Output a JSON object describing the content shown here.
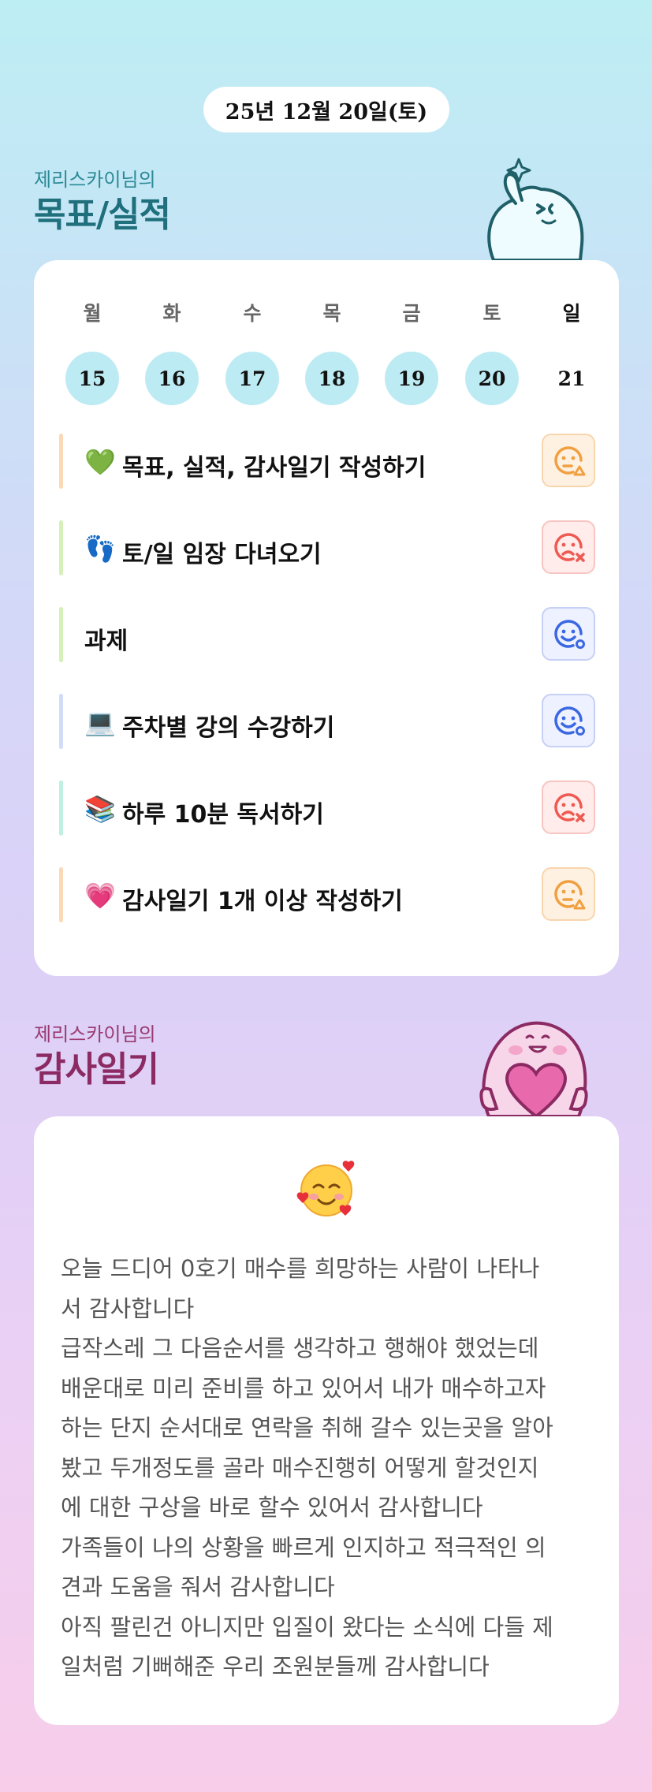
{
  "date_label": "25년 12월 20일(토)",
  "goals_section": {
    "subtitle": "제리스카이님의",
    "title": "목표/실적"
  },
  "week": {
    "day_names": [
      "월",
      "화",
      "수",
      "목",
      "금",
      "토",
      "일"
    ],
    "day_numbers": [
      "15",
      "16",
      "17",
      "18",
      "19",
      "20",
      "21"
    ]
  },
  "goals": [
    {
      "emoji": "💚",
      "text": "목표, 실적, 감사일기 작성하기",
      "status_icon": "neutral-face-warning-icon",
      "bar_color": "#fbd9b6"
    },
    {
      "emoji": "👣",
      "text": "토/일 임장 다녀오기",
      "status_icon": "sad-face-x-icon",
      "bar_color": "#d5f0b8"
    },
    {
      "emoji": "",
      "text": "과제",
      "status_icon": "smile-face-check-icon",
      "bar_color": "#d5f0b8"
    },
    {
      "emoji": "💻",
      "text": "주차별 강의 수강하기",
      "status_icon": "smile-face-check-icon",
      "bar_color": "#d2dcf8"
    },
    {
      "emoji": "📚",
      "text": "하루 10분 독서하기",
      "status_icon": "sad-face-x-icon",
      "bar_color": "#bff0e2"
    },
    {
      "emoji": "💗",
      "text": "감사일기 1개 이상 작성하기",
      "status_icon": "neutral-face-warning-icon",
      "bar_color": "#fbd9b6"
    }
  ],
  "colors": {
    "warn": "#f0a040",
    "fail": "#ee5a52",
    "good": "#3a68e2",
    "teal_title": "#1f6f7c",
    "pink_title": "#8c2a63"
  },
  "diary_section": {
    "subtitle": "제리스카이님의",
    "title": "감사일기"
  },
  "diary": {
    "emoji_icon": "smiling-face-with-hearts-icon",
    "lines": [
      "오늘 드디어 0호기 매수를 희망하는 사람이 나타나",
      "서 감사합니다",
      "급작스레 그 다음순서를 생각하고 행해야 했었는데",
      "배운대로 미리 준비를 하고 있어서 내가 매수하고자",
      "하는 단지 순서대로 연락을 취해 갈수 있는곳을 알아",
      "봤고 두개정도를 골라 매수진행히 어떻게 할것인지",
      "에 대한 구상을 바로 할수 있어서 감사합니다",
      "가족들이 나의 상황을 빠르게 인지하고 적극적인 의",
      "견과 도움을 줘서 감사합니다",
      "아직 팔린건 아니지만 입질이 왔다는 소식에 다들 제",
      "일처럼 기뻐해준 우리 조원분들께 감사합니다"
    ]
  }
}
